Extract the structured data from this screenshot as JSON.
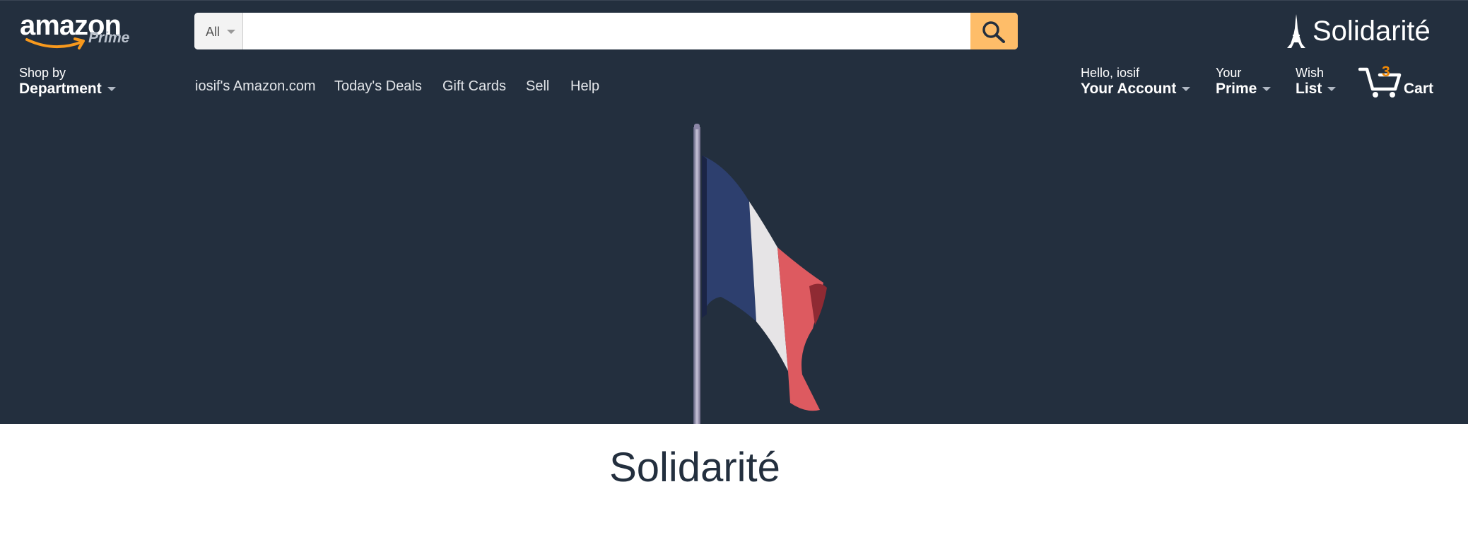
{
  "logo": {
    "word": "amazon",
    "sub": "Prime"
  },
  "search": {
    "category": "All",
    "placeholder": "",
    "value": ""
  },
  "brand": {
    "text": "Solidarité",
    "icon": "eiffel-tower-icon"
  },
  "department": {
    "small": "Shop by",
    "big": "Department"
  },
  "nav_links": [
    "iosif's Amazon.com",
    "Today's Deals",
    "Gift Cards",
    "Sell",
    "Help"
  ],
  "account": {
    "small": "Hello, iosif",
    "big": "Your Account"
  },
  "prime": {
    "small": "Your",
    "big": "Prime"
  },
  "wishlist": {
    "small": "Wish",
    "big": "List"
  },
  "cart": {
    "count": "3",
    "label": "Cart"
  },
  "hero": {
    "image": "french-flag-on-pole",
    "colors": {
      "blue": "#2d3f6e",
      "white": "#e6e4e6",
      "red": "#dd5a60"
    }
  },
  "headline": "Solidarité",
  "colors": {
    "nav_bg": "#232f3e",
    "search_button": "#febd69",
    "cart_count": "#f08804"
  }
}
